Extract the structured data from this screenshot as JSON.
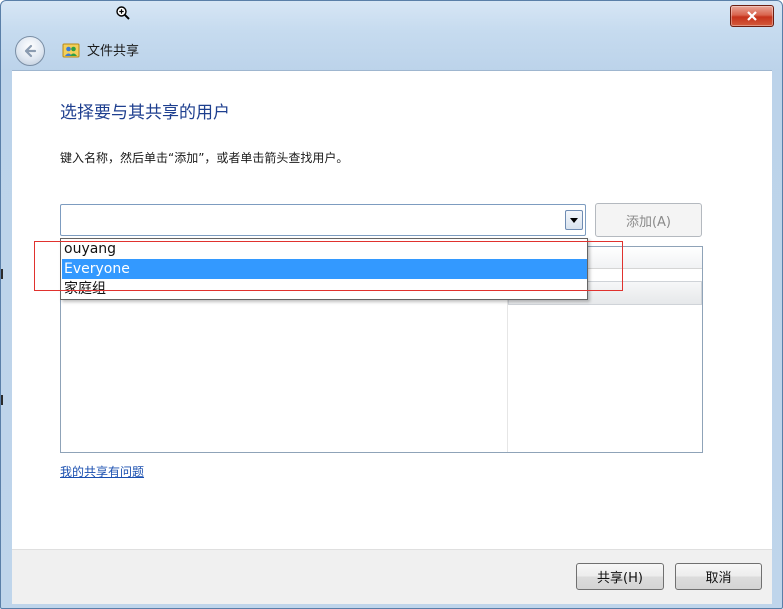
{
  "window": {
    "title": "文件共享"
  },
  "main": {
    "heading": "选择要与其共享的用户",
    "instruction": "键入名称，然后单击“添加”，或者单击箭头查找用户。",
    "combo_value": "",
    "add_button": "添加(A)",
    "dropdown_items": [
      "ouyang",
      "Everyone",
      "家庭组"
    ],
    "selected_item": "Everyone",
    "help_link": "我的共享有问题"
  },
  "footer": {
    "share_button": "共享(H)",
    "cancel_button": "取消"
  },
  "colors": {
    "heading": "#1e3f8f",
    "selection": "#3399ff",
    "highlight": "#e0322e",
    "link": "#1a4fb0"
  },
  "icons": [
    "zoom-in-cursor-icon",
    "close-icon",
    "back-arrow-icon",
    "share-users-icon",
    "dropdown-arrow-icon"
  ]
}
